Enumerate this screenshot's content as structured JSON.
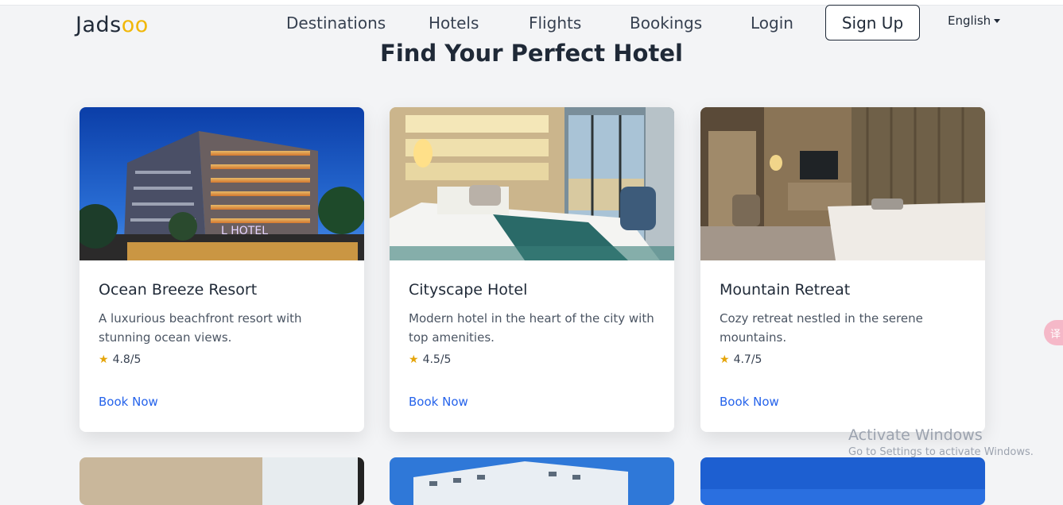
{
  "brand": {
    "name_main": "Jads",
    "name_accent": "oo",
    "accent_color": "#f1b708"
  },
  "nav": {
    "items": [
      "Destinations",
      "Hotels",
      "Flights",
      "Bookings",
      "Login"
    ],
    "signup_label": "Sign Up",
    "language": "English"
  },
  "main": {
    "title": "Find Your Perfect Hotel",
    "hotels": [
      {
        "name": "Ocean Breeze Resort",
        "description": "A luxurious beachfront resort with stunning ocean views.",
        "rating": "4.8/5",
        "cta": "Book Now",
        "image_sign": "L HOTEL"
      },
      {
        "name": "Cityscape Hotel",
        "description": "Modern hotel in the heart of the city with top amenities.",
        "rating": "4.5/5",
        "cta": "Book Now"
      },
      {
        "name": "Mountain Retreat",
        "description": "Cozy retreat nestled in the serene mountains.",
        "rating": "4.7/5",
        "cta": "Book Now"
      }
    ]
  },
  "overlay": {
    "activate_title": "Activate Windows",
    "activate_sub": "Go to Settings to activate Windows.",
    "side_button": "译"
  },
  "colors": {
    "link": "#2563eb",
    "star": "#e5a50a",
    "background": "#f3f4f6"
  }
}
